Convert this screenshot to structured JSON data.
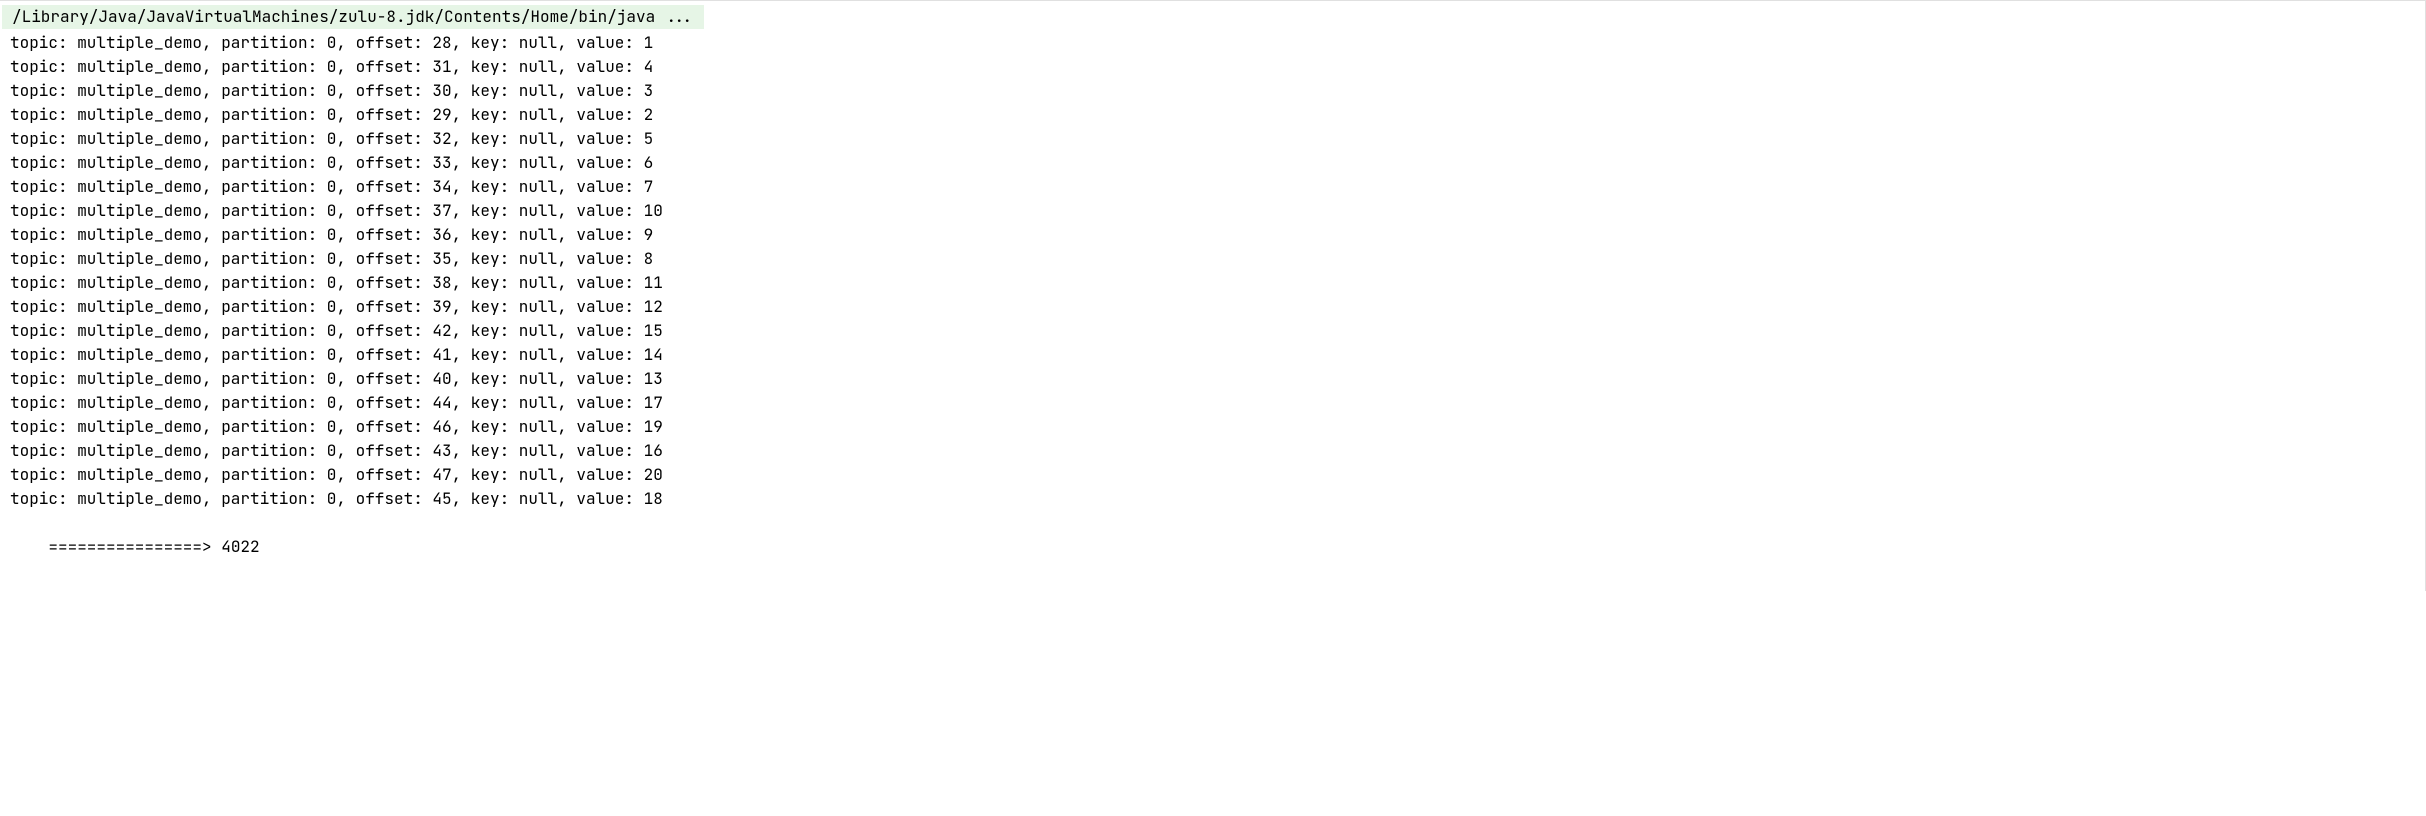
{
  "command_line": "/Library/Java/JavaVirtualMachines/zulu-8.jdk/Contents/Home/bin/java ...",
  "record_template": {
    "labels": {
      "topic": "topic",
      "partition": "partition",
      "offset": "offset",
      "key": "key",
      "value": "value"
    },
    "topic": "multiple_demo",
    "partition": 0,
    "key": "null"
  },
  "records": [
    {
      "offset": 28,
      "value": 1
    },
    {
      "offset": 31,
      "value": 4
    },
    {
      "offset": 30,
      "value": 3
    },
    {
      "offset": 29,
      "value": 2
    },
    {
      "offset": 32,
      "value": 5
    },
    {
      "offset": 33,
      "value": 6
    },
    {
      "offset": 34,
      "value": 7
    },
    {
      "offset": 37,
      "value": 10
    },
    {
      "offset": 36,
      "value": 9
    },
    {
      "offset": 35,
      "value": 8
    },
    {
      "offset": 38,
      "value": 11
    },
    {
      "offset": 39,
      "value": 12
    },
    {
      "offset": 42,
      "value": 15
    },
    {
      "offset": 41,
      "value": 14
    },
    {
      "offset": 40,
      "value": 13
    },
    {
      "offset": 44,
      "value": 17
    },
    {
      "offset": 46,
      "value": 19
    },
    {
      "offset": 43,
      "value": 16
    },
    {
      "offset": 47,
      "value": 20
    },
    {
      "offset": 45,
      "value": 18
    }
  ],
  "footer": {
    "arrow": "================>",
    "value": "4022"
  }
}
